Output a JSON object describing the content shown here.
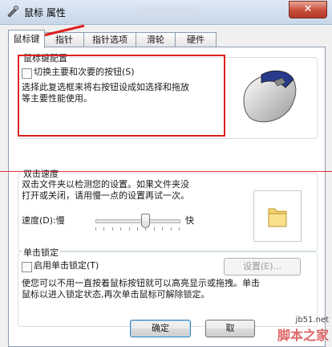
{
  "window": {
    "title": "鼠标 属性",
    "close_symbol": "✕"
  },
  "tabs": [
    {
      "label": "鼠标键"
    },
    {
      "label": "指针"
    },
    {
      "label": "指针选项"
    },
    {
      "label": "滑轮"
    },
    {
      "label": "硬件"
    }
  ],
  "button_config": {
    "title": "鼠标键配置",
    "checkbox_label": "切换主要和次要的按钮(S)",
    "description_line1": "选择此复选框来将右按钮设成如选择和拖放",
    "description_line2": "等主要性能使用。"
  },
  "double_click": {
    "title": "双击速度",
    "description_line1": "双击文件夹以检测您的设置。如果文件夹没",
    "description_line2": "打开或关闭，请用慢一点的设置再试一次。",
    "speed_label": "速度(D):慢",
    "fast_label": "快",
    "speed_level": 0.6
  },
  "click_lock": {
    "title": "单击锁定",
    "checkbox_label": "启用单击锁定(T)",
    "settings_button": "设置(E)...",
    "description_line1": "使您可以不用一直按着鼠标按钮就可以高亮显示或拖拽。单击",
    "description_line2": "鼠标以进入锁定状态,再次单击鼠标可解除锁定。"
  },
  "footer": {
    "ok": "确定",
    "cancel": "取"
  },
  "watermark": {
    "line1": "jb51.net",
    "line2": "脚本之家"
  },
  "colors": {
    "annotation_red": "#e02020",
    "tab_border": "#8e9db0"
  }
}
